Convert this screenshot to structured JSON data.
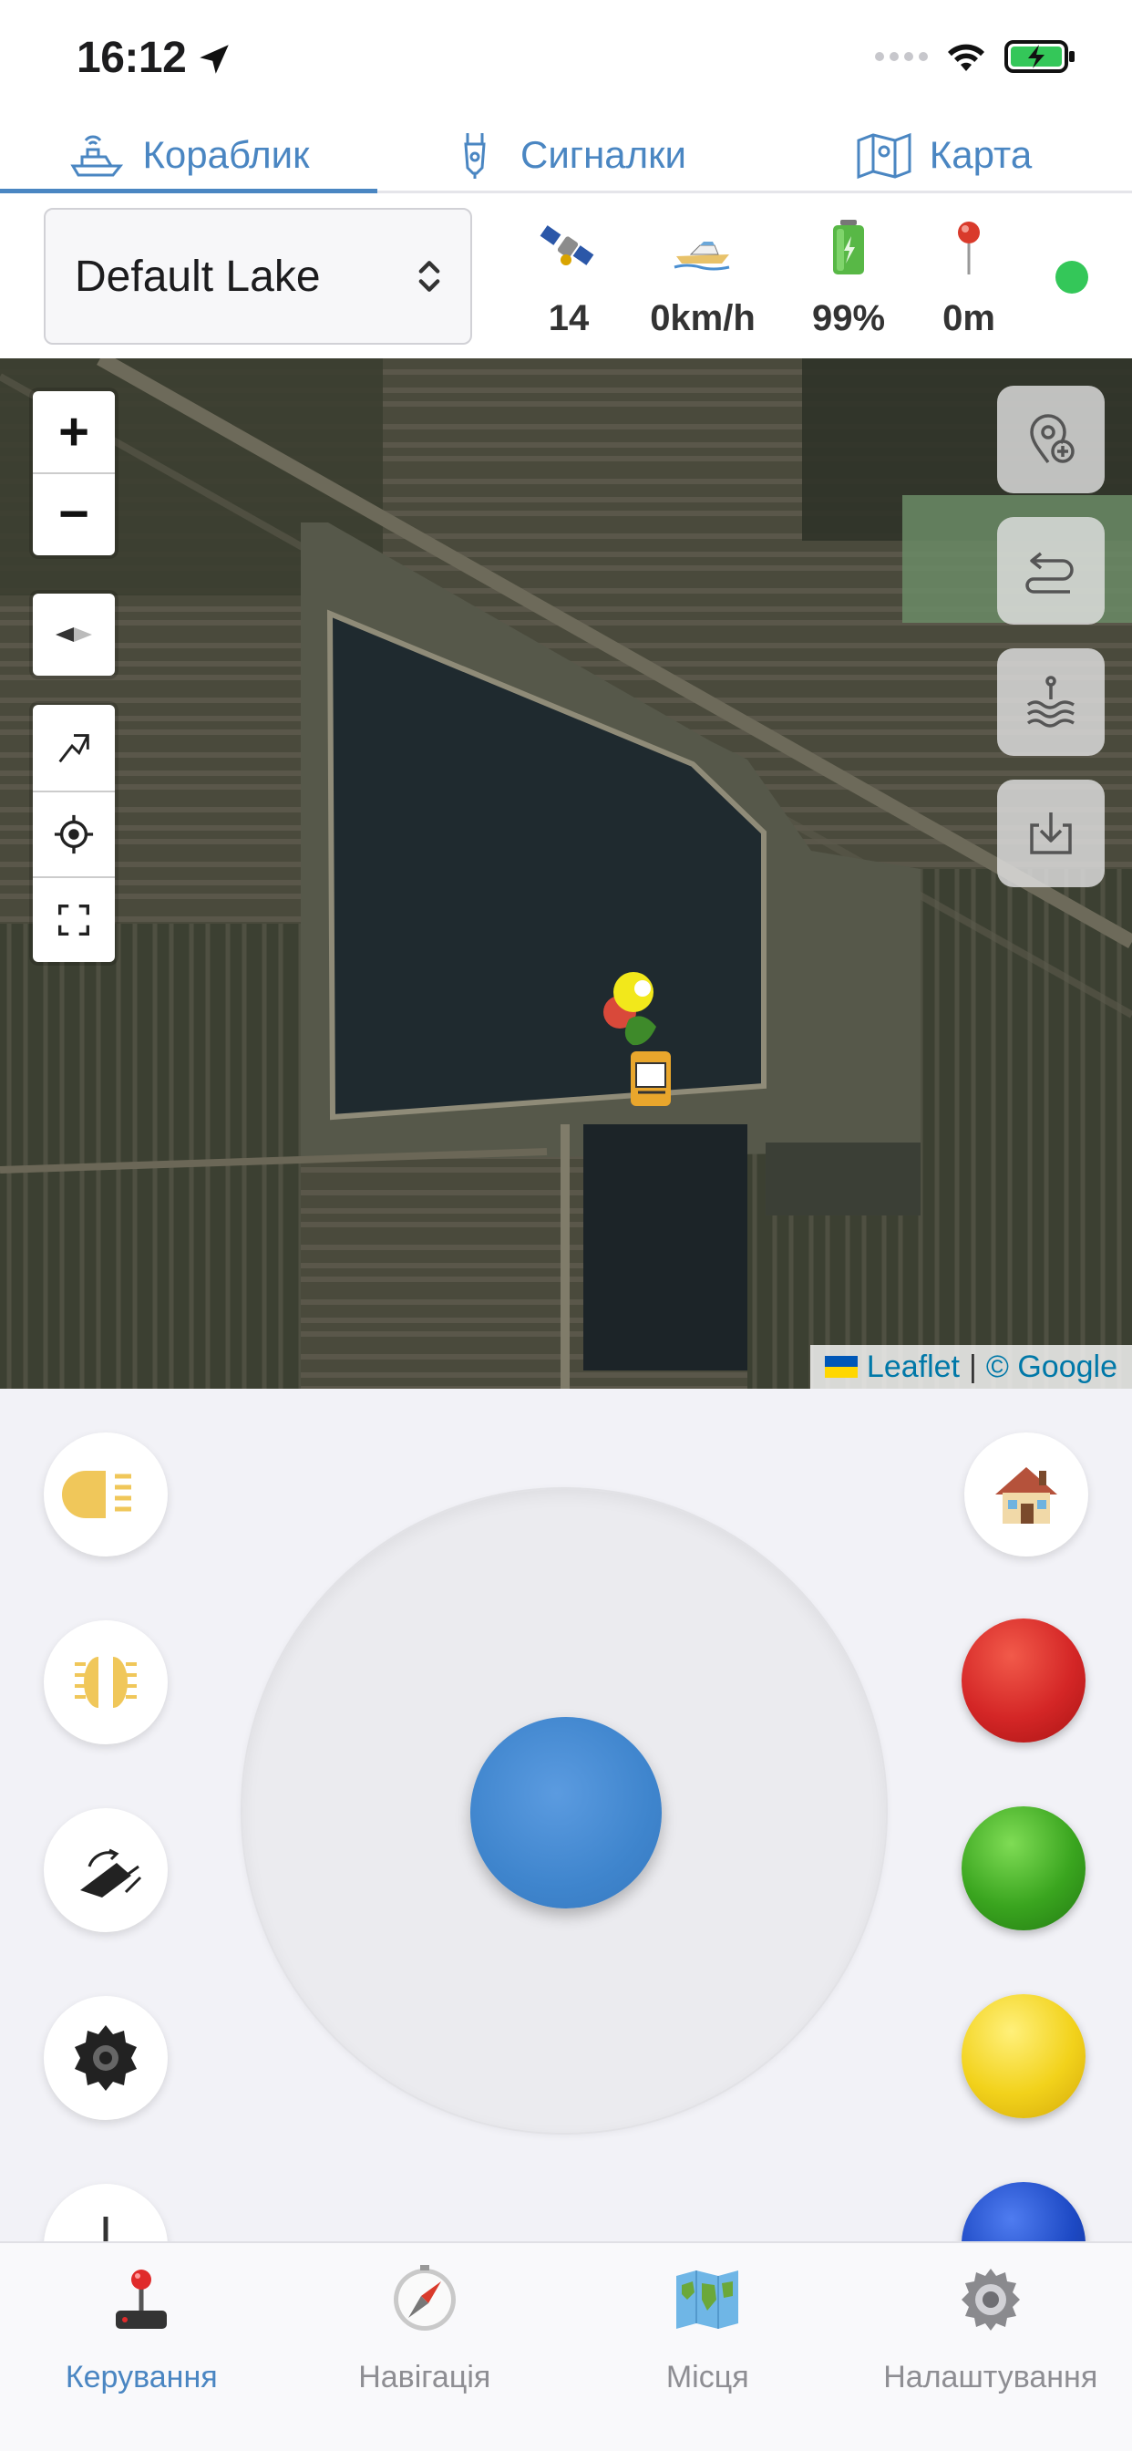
{
  "status_bar": {
    "time": "16:12"
  },
  "top_tabs": [
    {
      "label": "Кораблик",
      "icon": "boat-icon",
      "active": true
    },
    {
      "label": "Сигналки",
      "icon": "bite-alarm-icon",
      "active": false
    },
    {
      "label": "Карта",
      "icon": "map-icon",
      "active": false
    }
  ],
  "lake_select": {
    "value": "Default Lake"
  },
  "stats": {
    "satellites": "14",
    "speed": "0km/h",
    "battery": "99%",
    "distance": "0m"
  },
  "connection_color": "#34c759",
  "map": {
    "zoom_in": "+",
    "zoom_out": "−",
    "attribution_leaflet": "Leaflet",
    "attribution_sep": "|",
    "attribution_google": "© Google"
  },
  "bottom_nav": [
    {
      "label": "Керування",
      "icon": "joystick-icon",
      "active": true
    },
    {
      "label": "Навігація",
      "icon": "compass-icon",
      "active": false
    },
    {
      "label": "Місця",
      "icon": "world-map-icon",
      "active": false
    },
    {
      "label": "Налаштування",
      "icon": "gear-icon",
      "active": false
    }
  ],
  "colors": {
    "accent": "#4a86c2",
    "joystick": "#3f85cd",
    "red_ball": "#d42626",
    "green_ball": "#3aa51f",
    "yellow_ball": "#f2d21b",
    "blue_ball": "#1d49c4"
  }
}
